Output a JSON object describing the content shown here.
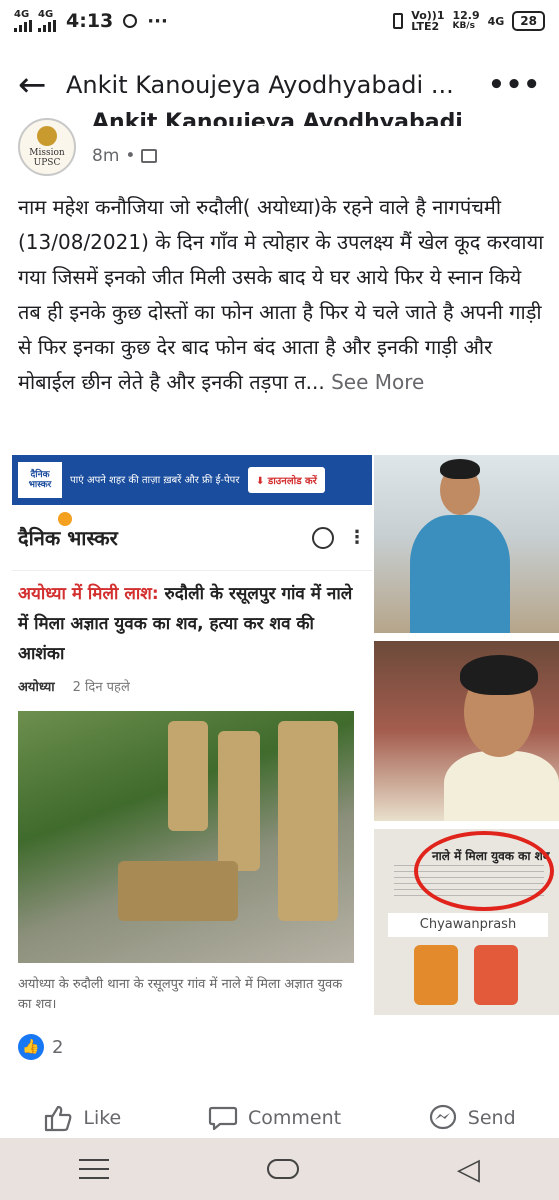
{
  "status_bar": {
    "signal1": "4G",
    "signal2": "4G",
    "time": "4:13",
    "volte_top": "Vo))",
    "volte_bottom": "LTE2",
    "lte_num": "1",
    "speed_top": "12.9",
    "speed_bottom": "KB/s",
    "net": "4G",
    "battery": "28"
  },
  "app_bar": {
    "back_glyph": "←",
    "title": "Ankit Kanoujeya Ayodhyabadi ...",
    "more_glyph": "•••"
  },
  "post": {
    "author": "Ankit Kanoujeya Ayodhyabadi",
    "avatar_text_top": "Mission",
    "avatar_text_bottom": "UPSC",
    "time": "8m",
    "separator": "•",
    "body": "नाम महेश कनौजिया जो रुदौली( अयोध्या)के रहने वाले है नागपंचमी (13/08/2021) के दिन गाँव मे त्योहार  के उपलक्ष्य मैं खेल  कूद करवाया गया जिसमें इनको जीत मिली उसके बाद ये घर आये  फिर ये स्नान किये तब ही इनके कुछ दोस्तों का फोन आता है  फिर ये चले जाते है अपनी गाड़ी से फिर इनका कुछ देर बाद फोन बंद आता है  और इनकी गाड़ी और मोबाईल छीन लेते है  और इनकी तड़पा त...",
    "see_more": "See More"
  },
  "news_card": {
    "brand_box": "दैनिक भास्कर",
    "banner_text": "पाएं अपने शहर की ताज़ा ख़बरें और फ्री ई-पेपर",
    "download_label": "⬇ डाउनलोड करें",
    "logo_text": "दैनिक भास्कर",
    "more_glyph": "⋮",
    "headline_red": "अयोध्या में मिली लाश:",
    "headline_rest": " रुदौली के रसूलपुर गांव में नाले में मिला अज्ञात युवक का शव, हत्या कर शव की आशंका",
    "location": "अयोध्या",
    "age": "2 दिन पहले",
    "caption": "अयोध्या के रुदौली थाना के रसूलपुर गांव में नाले में मिला अज्ञात युवक का शव।"
  },
  "paper_clip": {
    "title": "नाले में मिला युवक का शव",
    "brand": "Chyawanprash"
  },
  "reactions": {
    "like_glyph": "👍",
    "count": "2"
  },
  "actions": {
    "like": "Like",
    "comment": "Comment",
    "send": "Send"
  },
  "nav": {
    "back_glyph": "◁"
  },
  "colors": {
    "accent": "#1877f2",
    "headline_red": "#d32f2f",
    "muted": "#65676b"
  }
}
